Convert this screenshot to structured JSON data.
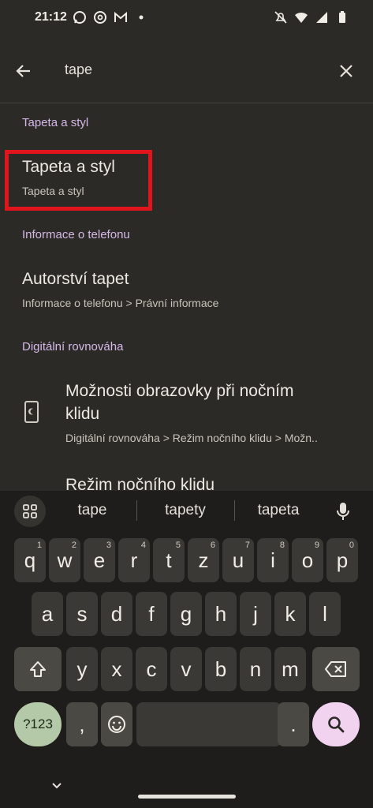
{
  "status": {
    "time": "21:12",
    "icons_left": [
      "whatsapp-icon",
      "threads-icon",
      "gmail-icon",
      "dot-icon"
    ],
    "icons_right": [
      "mute-icon",
      "wifi-icon",
      "signal-icon",
      "battery-icon"
    ]
  },
  "search": {
    "query": "tape"
  },
  "results": {
    "sections": [
      {
        "header": "Tapeta a styl",
        "items": [
          {
            "title": "Tapeta a styl",
            "subtitle": "Tapeta a styl"
          }
        ]
      },
      {
        "header": "Informace o telefonu",
        "items": [
          {
            "title": "Autorství tapet",
            "subtitle": "Informace o telefonu > Právní informace"
          }
        ]
      },
      {
        "header": "Digitální rovnováha",
        "items": [
          {
            "title_line1": "Možnosti obrazovky při nočním",
            "title_line2": "klidu",
            "subtitle": "Digitální rovnováha > Režim nočního klidu > Možn..",
            "icon": "phone-screen-icon"
          },
          {
            "title": "Režim nočního klidu"
          }
        ]
      }
    ]
  },
  "keyboard": {
    "suggestions": [
      "tape",
      "tapety",
      "tapeta"
    ],
    "row1": [
      {
        "k": "q",
        "h": "1"
      },
      {
        "k": "w",
        "h": "2"
      },
      {
        "k": "e",
        "h": "3"
      },
      {
        "k": "r",
        "h": "4"
      },
      {
        "k": "t",
        "h": "5"
      },
      {
        "k": "z",
        "h": "6"
      },
      {
        "k": "u",
        "h": "7"
      },
      {
        "k": "i",
        "h": "8"
      },
      {
        "k": "o",
        "h": "9"
      },
      {
        "k": "p",
        "h": "0"
      }
    ],
    "row2": [
      "a",
      "s",
      "d",
      "f",
      "g",
      "h",
      "j",
      "k",
      "l"
    ],
    "row3": [
      "y",
      "x",
      "c",
      "v",
      "b",
      "n",
      "m"
    ],
    "num_label": "?123",
    "comma": ",",
    "period": "."
  },
  "colors": {
    "background": "#2b2a26",
    "section_header": "#d6b8e8",
    "highlight": "#e0141b",
    "num_key": "#b4c9a8",
    "search_key": "#f1d3ef"
  }
}
